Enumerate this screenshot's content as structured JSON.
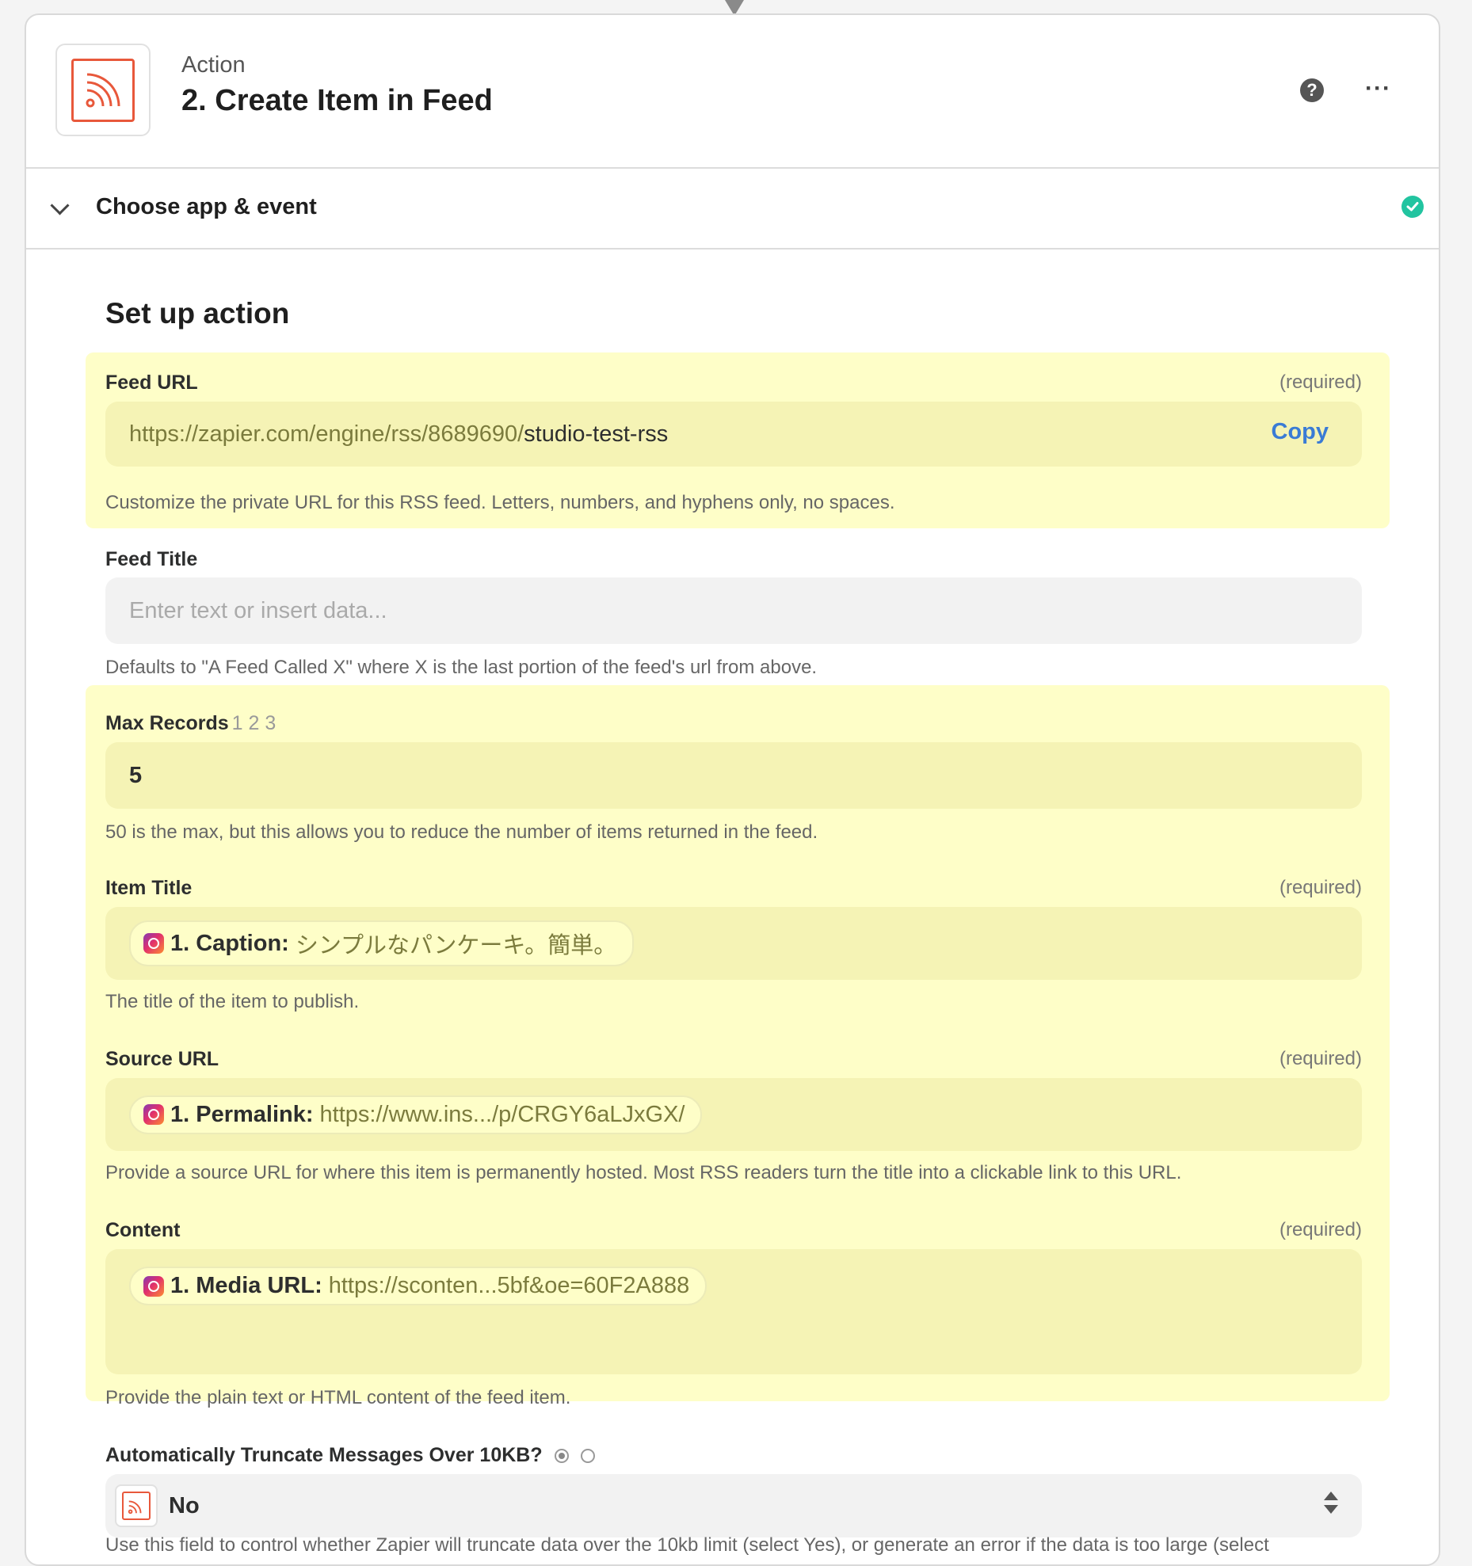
{
  "colors": {
    "brand_rss": "#e8583b",
    "highlight": "#fefec8",
    "link": "#3a7bd5",
    "success": "#22c4a0"
  },
  "header": {
    "app_icon": "rss-icon",
    "kicker": "Action",
    "title": "2. Create Item in Feed",
    "help_icon": "question-circle-icon",
    "help_glyph": "?",
    "more_icon": "ellipsis-icon",
    "more_glyph": "···"
  },
  "section": {
    "title": "Choose app & event",
    "status_icon": "check-circle-icon"
  },
  "setup": {
    "title": "Set up action",
    "fields": {
      "feed_url": {
        "label": "Feed URL",
        "required": "(required)",
        "prefix": "https://zapier.com/engine/rss/8689690/",
        "value": "studio-test-rss",
        "copy_label": "Copy",
        "help": "Customize the private URL for this RSS feed. Letters, numbers, and hyphens only, no spaces."
      },
      "feed_title": {
        "label": "Feed Title",
        "placeholder": "Enter text or insert data...",
        "help": "Defaults to \"A Feed Called X\" where X is the last portion of the feed's url from above."
      },
      "max_records": {
        "label": "Max Records",
        "hint_numbers": "1 2 3",
        "value": "5",
        "help": "50 is the max, but this allows you to reduce the number of items returned in the feed."
      },
      "item_title": {
        "label": "Item Title",
        "required": "(required)",
        "pill_icon": "instagram-icon",
        "pill_key": "1. Caption:",
        "pill_value": "シンプルなパンケーキ。簡単。",
        "help": "The title of the item to publish."
      },
      "source_url": {
        "label": "Source URL",
        "required": "(required)",
        "pill_icon": "instagram-icon",
        "pill_key": "1. Permalink:",
        "pill_value": "https://www.ins.../p/CRGY6aLJxGX/",
        "help": "Provide a source URL for where this item is permanently hosted. Most RSS readers turn the title into a clickable link to this URL."
      },
      "content": {
        "label": "Content",
        "required": "(required)",
        "pill_icon": "instagram-icon",
        "pill_key": "1. Media URL:",
        "pill_value": "https://sconten...5bf&oe=60F2A888",
        "help": "Provide the plain text or HTML content of the feed item."
      },
      "truncate": {
        "label": "Automatically Truncate Messages Over 10KB?",
        "select_icon": "rss-icon",
        "value": "No",
        "help": "Use this field to control whether Zapier will truncate data over the 10kb limit (select Yes), or generate an error if the data is too large (select"
      }
    }
  }
}
